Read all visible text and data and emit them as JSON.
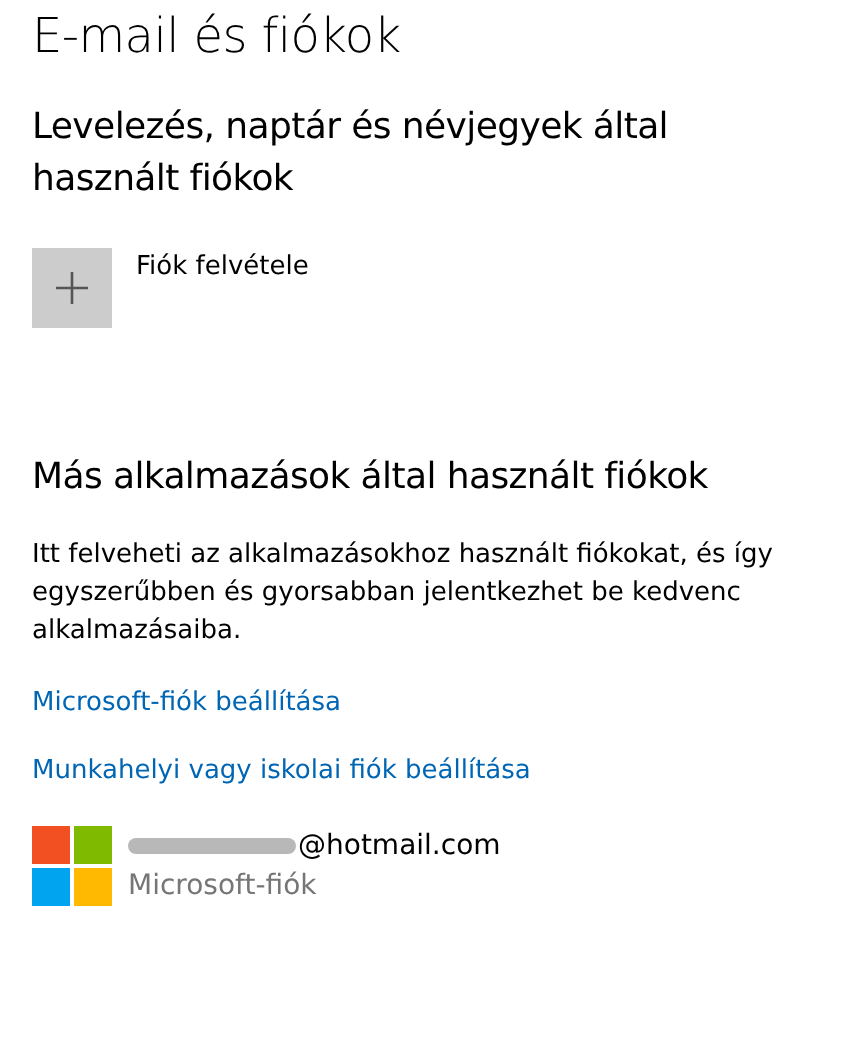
{
  "title": "E-mail és fiókok",
  "sections": [
    {
      "heading": "Levelezés, naptár és névjegyek által használt fiókok",
      "add_account": {
        "label": "Fiók felvétele"
      }
    },
    {
      "heading": "Más alkalmazások által használt fiókok",
      "description": "Itt felveheti az alkalmazásokhoz használt fiókokat, és így egyszerűbben és gyorsabban jelentkezhet be kedvenc alkalmazásaiba.",
      "links": [
        "Microsoft-fiók beállítása",
        "Munkahelyi vagy iskolai fiók beállítása"
      ],
      "accounts": [
        {
          "email": "@hotmail.com",
          "redacted": true,
          "type": "Microsoft-fiók"
        }
      ]
    }
  ]
}
